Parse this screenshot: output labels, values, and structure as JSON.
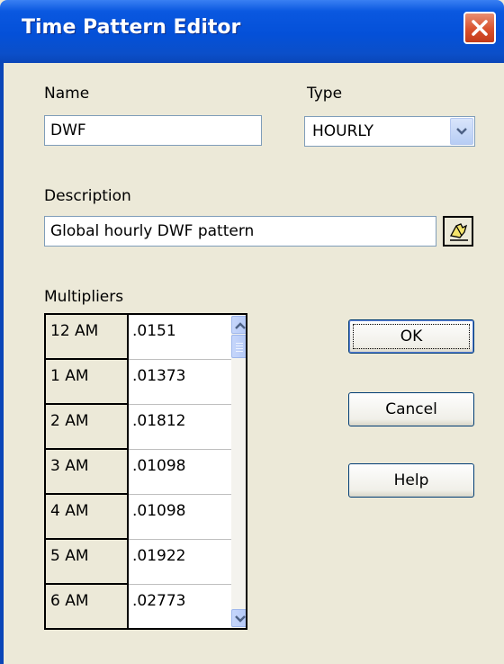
{
  "window": {
    "title": "Time Pattern Editor"
  },
  "name": {
    "label": "Name",
    "value": "DWF"
  },
  "type": {
    "label": "Type",
    "value": "HOURLY"
  },
  "description": {
    "label": "Description",
    "value": "Global hourly DWF pattern"
  },
  "multipliers": {
    "label": "Multipliers",
    "rows": [
      {
        "hour": "12 AM",
        "value": ".0151"
      },
      {
        "hour": "1 AM",
        "value": ".01373"
      },
      {
        "hour": "2 AM",
        "value": ".01812"
      },
      {
        "hour": "3 AM",
        "value": ".01098"
      },
      {
        "hour": "4 AM",
        "value": ".01098"
      },
      {
        "hour": "5 AM",
        "value": ".01922"
      },
      {
        "hour": "6 AM",
        "value": ".02773"
      }
    ]
  },
  "buttons": {
    "ok": "OK",
    "cancel": "Cancel",
    "help": "Help"
  },
  "colors": {
    "titlebar": "#0450d8",
    "close": "#d9512d",
    "dialog_bg": "#ece9d8"
  },
  "icons": {
    "close": "close-icon",
    "dropdown": "chevron-down-icon",
    "edit": "edit-icon"
  }
}
